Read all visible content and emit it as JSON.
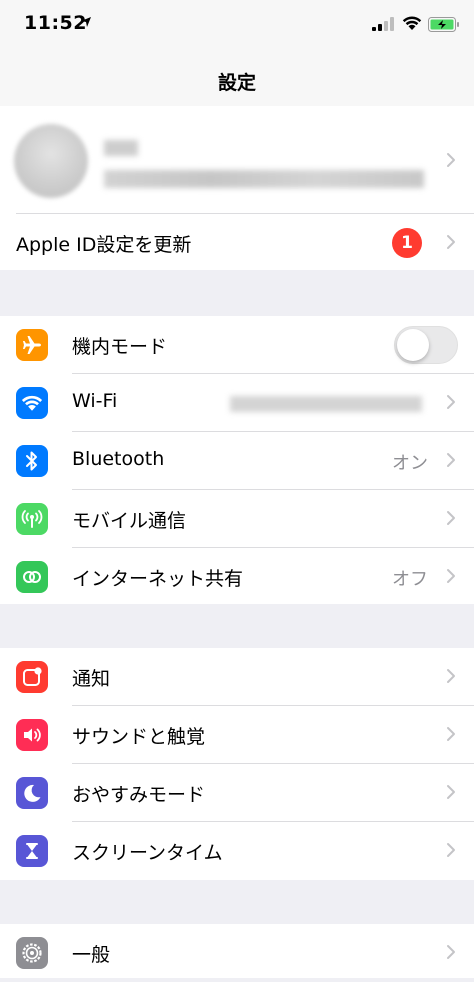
{
  "status_bar": {
    "time": "11:52"
  },
  "nav": {
    "title": "設定"
  },
  "profile": {},
  "apple_id": {
    "label": "Apple ID設定を更新",
    "badge": "1"
  },
  "connectivity": [
    {
      "id": "airplane",
      "label": "機内モード",
      "icon": "airplane-icon",
      "color": "#ff9500",
      "toggle": false
    },
    {
      "id": "wifi",
      "label": "Wi-Fi",
      "icon": "wifi-icon",
      "color": "#007aff",
      "value": ""
    },
    {
      "id": "bluetooth",
      "label": "Bluetooth",
      "icon": "bluetooth-icon",
      "color": "#007aff",
      "value": "オン"
    },
    {
      "id": "cellular",
      "label": "モバイル通信",
      "icon": "antenna-icon",
      "color": "#4cd964",
      "value": ""
    },
    {
      "id": "hotspot",
      "label": "インターネット共有",
      "icon": "link-icon",
      "color": "#34c759",
      "value": "オフ"
    }
  ],
  "notifications_group": [
    {
      "id": "notifications",
      "label": "通知",
      "icon": "notification-icon",
      "color": "#ff3b30"
    },
    {
      "id": "sounds",
      "label": "サウンドと触覚",
      "icon": "speaker-icon",
      "color": "#ff2d55"
    },
    {
      "id": "dnd",
      "label": "おやすみモード",
      "icon": "moon-icon",
      "color": "#5856d6"
    },
    {
      "id": "screentime",
      "label": "スクリーンタイム",
      "icon": "hourglass-icon",
      "color": "#5856d6"
    }
  ],
  "general_group": [
    {
      "id": "general",
      "label": "一般",
      "icon": "gear-icon",
      "color": "#8e8e93"
    }
  ]
}
